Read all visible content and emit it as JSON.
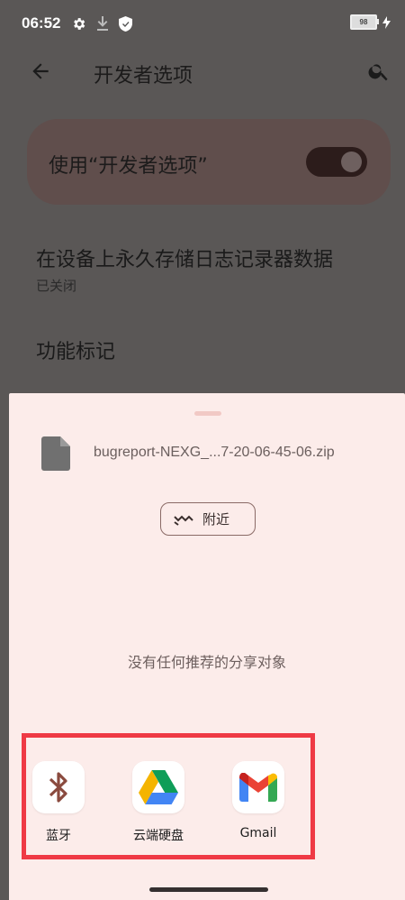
{
  "status_bar": {
    "time": "06:52",
    "battery_level": "98"
  },
  "app_bar": {
    "title": "开发者选项"
  },
  "settings": {
    "toggle_label": "使用“开发者选项”",
    "toggle_on": true,
    "item1_title": "在设备上永久存储日志记录器数据",
    "item1_subtitle": "已关闭",
    "item2_title": "功能标记"
  },
  "share_sheet": {
    "file_name": "bugreport-NEXG_...7-20-06-45-06.zip",
    "nearby_label": "附近",
    "no_recommendation": "没有任何推荐的分享对象",
    "targets": [
      {
        "label": "蓝牙",
        "icon": "bluetooth-icon"
      },
      {
        "label": "云端硬盘",
        "icon": "google-drive-icon"
      },
      {
        "label": "Gmail",
        "icon": "gmail-icon"
      }
    ]
  },
  "colors": {
    "sheet_bg": "#fcecea",
    "highlight": "#ef3a45",
    "dim_overlay": "#5a5756"
  }
}
